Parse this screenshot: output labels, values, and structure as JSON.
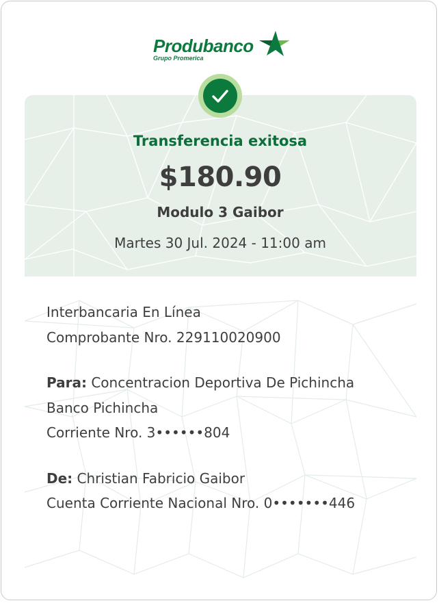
{
  "brand": {
    "name": "Produbanco",
    "subtitle": "Grupo Promerica",
    "colors": {
      "primary_green": "#0c7a3e",
      "light_green": "#b9dd9e",
      "header_bg": "#e7efe9",
      "text": "#3e3e3e"
    }
  },
  "receipt": {
    "status_icon": "check-icon",
    "status": "Transferencia exitosa",
    "amount": "$180.90",
    "beneficiary_name": "Modulo 3 Gaibor",
    "datetime": "Martes 30 Jul. 2024 - 11:00 am"
  },
  "details": {
    "transfer_type": "Interbancaria En Línea",
    "voucher": "Comprobante Nro. 229110020900",
    "to": {
      "label": "Para:",
      "name": "Concentracion Deportiva De Pichincha",
      "bank": "Banco Pichincha",
      "account": "Corriente Nro. 3••••••804"
    },
    "from": {
      "label": "De:",
      "name": "Christian Fabricio Gaibor",
      "account": "Cuenta Corriente Nacional Nro. 0•••••••446"
    }
  }
}
